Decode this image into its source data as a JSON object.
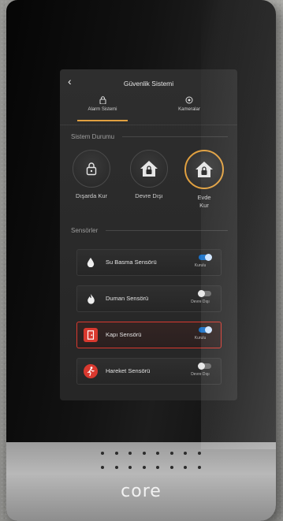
{
  "screen": {
    "title": "Güvenlik Sistemi",
    "back_icon": "‹",
    "tabs": [
      {
        "label": "Alarm Sistemi",
        "icon": "lock-icon"
      },
      {
        "label": "Kameralar",
        "icon": "camera-icon"
      }
    ],
    "section_status": "Sistem Durumu",
    "modes": [
      {
        "label": "Dışarda Kur"
      },
      {
        "label": "Devre Dışı"
      },
      {
        "label": "Evde Kur"
      }
    ],
    "section_sensors": "Sensörler",
    "sensors": [
      {
        "name": "Su Basma Sensörü",
        "state": "Kurulu",
        "on": true
      },
      {
        "name": "Duman Sensörü",
        "state": "Devre Dışı",
        "on": false
      },
      {
        "name": "Kapı Sensörü",
        "state": "Kurulu",
        "on": true,
        "alert": true
      },
      {
        "name": "Hareket Sensörü",
        "state": "Devre Dışı",
        "on": false
      }
    ]
  },
  "device": {
    "brand": "core"
  },
  "colors": {
    "accent": "#e0a040",
    "alert": "#d9392f",
    "toggle_on": "#1a72c9"
  }
}
